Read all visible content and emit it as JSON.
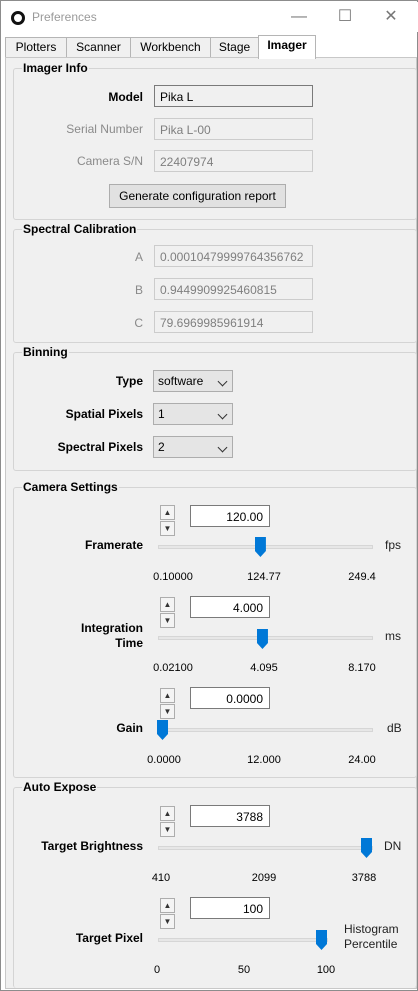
{
  "window": {
    "title": "Preferences",
    "minimize": "—",
    "maximize": "☐",
    "close": "✕"
  },
  "tabs": [
    {
      "label": "Plotters"
    },
    {
      "label": "Scanner"
    },
    {
      "label": "Workbench"
    },
    {
      "label": "Stage"
    },
    {
      "label": "Imager",
      "active": true
    }
  ],
  "imager_info": {
    "title": "Imager Info",
    "model_label": "Model",
    "model_value": "Pika L",
    "serial_label": "Serial Number",
    "serial_value": "Pika L-00",
    "camera_label": "Camera S/N",
    "camera_value": "22407974",
    "report_button": "Generate configuration report"
  },
  "spectral_calibration": {
    "title": "Spectral Calibration",
    "a_label": "A",
    "a_value": "0.00010479999764356762",
    "b_label": "B",
    "b_value": "0.9449909925460815",
    "c_label": "C",
    "c_value": "79.6969985961914"
  },
  "binning": {
    "title": "Binning",
    "type_label": "Type",
    "type_value": "software",
    "spatial_label": "Spatial Pixels",
    "spatial_value": "1",
    "spectral_label": "Spectral Pixels",
    "spectral_value": "2"
  },
  "camera_settings": {
    "title": "Camera Settings",
    "framerate": {
      "label": "Framerate",
      "value": "120.00",
      "unit": "fps",
      "min": "0.10000",
      "mid": "124.77",
      "max": "249.4",
      "fraction": 0.48
    },
    "integration": {
      "label_line1": "Integration",
      "label_line2": "Time",
      "value": "4.000",
      "unit": "ms",
      "min": "0.02100",
      "mid": "4.095",
      "max": "8.170",
      "fraction": 0.49
    },
    "gain": {
      "label": "Gain",
      "value": "0.0000",
      "unit": "dB",
      "min": "0.0000",
      "mid": "12.000",
      "max": "24.00",
      "fraction": 0.0
    }
  },
  "auto_expose": {
    "title": "Auto Expose",
    "target_brightness": {
      "label": "Target Brightness",
      "value": "3788",
      "unit": "DN",
      "min": "410",
      "mid": "2099",
      "max": "3788",
      "fraction": 1.0
    },
    "target_pixel": {
      "label": "Target Pixel",
      "value": "100",
      "unit_line1": "Histogram",
      "unit_line2": "Percentile",
      "min": "0",
      "mid": "50",
      "max": "100",
      "fraction": 1.0
    }
  },
  "spinner": {
    "up": "▲",
    "down": "▼"
  },
  "colors": {
    "accent": "#0078d7",
    "panel": "#f0f0f0"
  }
}
